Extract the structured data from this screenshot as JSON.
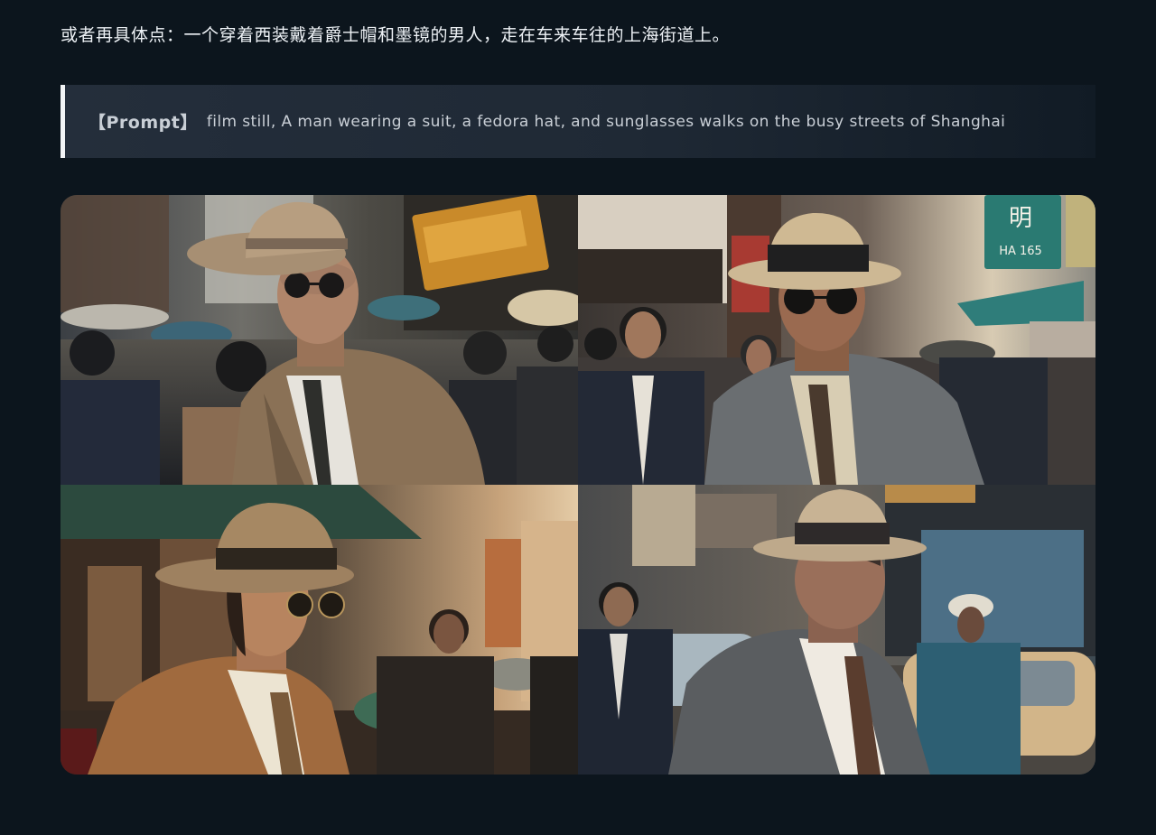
{
  "heading": "或者再具体点：一个穿着西装戴着爵士帽和墨镜的男人，走在车来车往的上海街道上。",
  "prompt": {
    "tag": "【Prompt】",
    "text": "film still, A man wearing a suit, a fedora hat, and sunglasses walks on the busy streets of Shanghai"
  },
  "images": [
    {
      "name": "generated-image-1"
    },
    {
      "name": "generated-image-2",
      "sign_text": "明",
      "sign_subtext": "HA 165"
    },
    {
      "name": "generated-image-3"
    },
    {
      "name": "generated-image-4"
    }
  ],
  "colors": {
    "background": "#0c151d",
    "prompt_bar_accent": "#f2f4f6",
    "text_primary": "#eef2f6",
    "text_secondary": "#c9cfd6"
  }
}
